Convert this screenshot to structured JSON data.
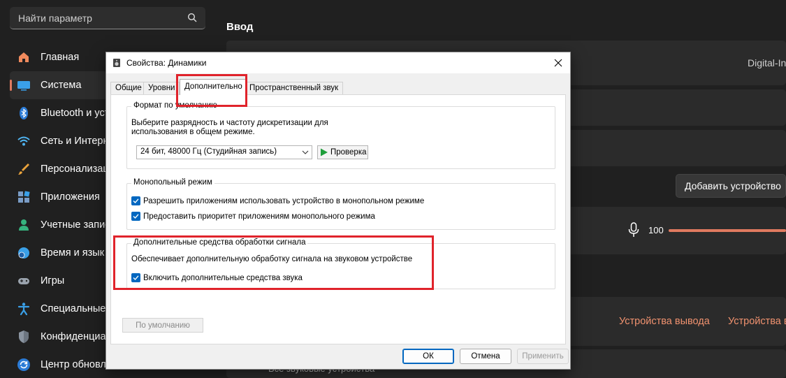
{
  "settings": {
    "search_placeholder": "Найти параметр",
    "nav": [
      {
        "label": "Главная"
      },
      {
        "label": "Система"
      },
      {
        "label": "Bluetooth и устройства"
      },
      {
        "label": "Сеть и Интернет"
      },
      {
        "label": "Персонализация"
      },
      {
        "label": "Приложения"
      },
      {
        "label": "Учетные записи"
      },
      {
        "label": "Время и язык"
      },
      {
        "label": "Игры"
      },
      {
        "label": "Специальные возможности"
      },
      {
        "label": "Конфиденциальность и защита"
      },
      {
        "label": "Центр обновления Windows"
      }
    ],
    "section_title": "Ввод",
    "device_name_partial": "Digital-In",
    "add_device_label": "Добавить устройство",
    "volume_value": "100",
    "tab_output_devices": "Устройства вывода",
    "tab_input_devices": "Устройства в",
    "bottom_partial": "Все звуковые устройства",
    "accent": "#e07a5f"
  },
  "dialog": {
    "title": "Свойства: Динамики",
    "tabs": [
      "Общие",
      "Уровни",
      "Дополнительно",
      "Пространственный звук"
    ],
    "active_tab": "Дополнительно",
    "default_format": {
      "title": "Формат по умолчанию",
      "description_line1": "Выберите разрядность и частоту дискретизации для",
      "description_line2": "использования в общем режиме.",
      "selected_format": "24 бит, 48000 Гц (Студийная запись)",
      "test_label": "Проверка"
    },
    "exclusive_mode": {
      "title": "Монопольный режим",
      "option1": "Разрешить приложениям использовать устройство в монопольном режиме",
      "option1_checked": true,
      "option2": "Предоставить приоритет приложениям монопольного режима",
      "option2_checked": true
    },
    "enhancements": {
      "title": "Дополнительные средства обработки сигнала",
      "description": "Обеспечивает дополнительную обработку сигнала на звуковом устройстве",
      "option": "Включить дополнительные средства звука",
      "option_checked": true
    },
    "restore_defaults_label": "По умолчанию",
    "ok_label": "ОК",
    "cancel_label": "Отмена",
    "apply_label": "Применить",
    "highlight_color": "#e0232b"
  }
}
